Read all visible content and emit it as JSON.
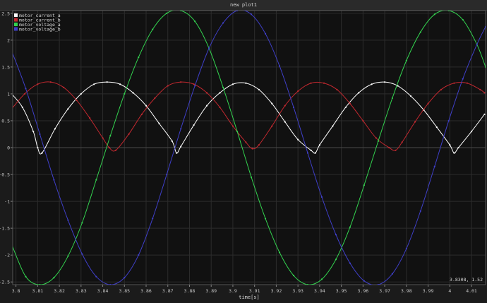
{
  "window": {
    "title": "new plot1"
  },
  "cursor_readout": "3.8308, 1.52",
  "chart_data": {
    "type": "line",
    "title": "new plot1",
    "xlabel": "time[s]",
    "ylabel": "",
    "xlim": [
      3.7985,
      4.0165
    ],
    "ylim": [
      -2.55,
      2.55
    ],
    "grid": true,
    "legend_position": "top-left",
    "x_ticks": [
      3.8,
      3.81,
      3.82,
      3.83,
      3.84,
      3.85,
      3.86,
      3.87,
      3.88,
      3.89,
      3.9,
      3.91,
      3.92,
      3.93,
      3.94,
      3.95,
      3.96,
      3.97,
      3.98,
      3.99,
      4.0,
      4.01
    ],
    "x_tick_labels": [
      "3.8",
      "3.81",
      "3.82",
      "3.83",
      "3.84",
      "3.85",
      "3.86",
      "3.87",
      "3.88",
      "3.89",
      "3.9",
      "3.91",
      "3.92",
      "3.93",
      "3.94",
      "3.95",
      "3.96",
      "3.97",
      "3.98",
      "3.99",
      "4",
      "4.01"
    ],
    "y_ticks": [
      2.5,
      2,
      1.5,
      1,
      0.5,
      0,
      -0.5,
      -1,
      -1.5,
      -2,
      -2.5
    ],
    "y_tick_labels": [
      "2.5",
      "2",
      "1.5",
      "1",
      "0.5",
      "0",
      "-0.5",
      "-1",
      "-1.5",
      "-2",
      "-2.5"
    ],
    "series": [
      {
        "name": "motor_current_a",
        "color": "#ffffff",
        "x": [
          3.798,
          3.803,
          3.808,
          3.81,
          3.812,
          3.818,
          3.824,
          3.83,
          3.836,
          3.842,
          3.848,
          3.854,
          3.86,
          3.866,
          3.872,
          3.874,
          3.876,
          3.882,
          3.888,
          3.894,
          3.9,
          3.906,
          3.912,
          3.918,
          3.924,
          3.93,
          3.936,
          3.938,
          3.94,
          3.946,
          3.952,
          3.958,
          3.964,
          3.97,
          3.976,
          3.982,
          3.988,
          3.994,
          4.0,
          4.002,
          4.004,
          4.01,
          4.016
        ],
        "y": [
          1.0,
          0.75,
          0.3,
          0.0,
          -0.1,
          0.35,
          0.72,
          1.0,
          1.18,
          1.22,
          1.18,
          1.02,
          0.78,
          0.45,
          0.12,
          -0.1,
          0.02,
          0.42,
          0.78,
          1.02,
          1.18,
          1.2,
          1.08,
          0.82,
          0.48,
          0.15,
          -0.05,
          -0.1,
          0.05,
          0.4,
          0.75,
          1.02,
          1.18,
          1.22,
          1.15,
          0.96,
          0.7,
          0.38,
          0.05,
          -0.1,
          0.0,
          0.3,
          0.62
        ]
      },
      {
        "name": "motor_current_b",
        "color": "#c0282f",
        "x": [
          3.798,
          3.804,
          3.81,
          3.816,
          3.822,
          3.828,
          3.834,
          3.84,
          3.843,
          3.846,
          3.852,
          3.858,
          3.864,
          3.87,
          3.876,
          3.882,
          3.888,
          3.894,
          3.9,
          3.906,
          3.909,
          3.912,
          3.918,
          3.924,
          3.93,
          3.936,
          3.942,
          3.948,
          3.954,
          3.96,
          3.966,
          3.972,
          3.975,
          3.978,
          3.984,
          3.99,
          3.996,
          4.002,
          4.008,
          4.014,
          4.016
        ],
        "y": [
          0.72,
          1.0,
          1.18,
          1.22,
          1.12,
          0.88,
          0.55,
          0.18,
          0.0,
          -0.05,
          0.25,
          0.62,
          0.92,
          1.15,
          1.22,
          1.18,
          1.02,
          0.75,
          0.4,
          0.1,
          -0.02,
          0.05,
          0.4,
          0.78,
          1.05,
          1.2,
          1.2,
          1.08,
          0.82,
          0.5,
          0.18,
          0.0,
          -0.05,
          0.1,
          0.48,
          0.82,
          1.08,
          1.2,
          1.2,
          1.08,
          1.02
        ]
      },
      {
        "name": "motor_voltage_a",
        "color": "#33d24f",
        "x": [
          3.798,
          3.8045,
          3.811,
          3.8175,
          3.824,
          3.8305,
          3.837,
          3.8435,
          3.85,
          3.8565,
          3.863,
          3.8695,
          3.876,
          3.8825,
          3.889,
          3.8955,
          3.902,
          3.9085,
          3.915,
          3.9215,
          3.928,
          3.9345,
          3.941,
          3.9475,
          3.954,
          3.9605,
          3.967,
          3.9735,
          3.98,
          3.9865,
          3.993,
          3.9995,
          4.006,
          4.0125,
          4.0165
        ],
        "y": [
          -1.8,
          -2.4,
          -2.55,
          -2.42,
          -2.02,
          -1.4,
          -0.6,
          0.22,
          1.0,
          1.68,
          2.2,
          2.5,
          2.55,
          2.35,
          1.85,
          1.12,
          0.3,
          -0.55,
          -1.32,
          -1.95,
          -2.38,
          -2.55,
          -2.45,
          -2.08,
          -1.48,
          -0.7,
          0.12,
          0.92,
          1.62,
          2.15,
          2.48,
          2.55,
          2.38,
          1.92,
          1.5
        ]
      },
      {
        "name": "motor_voltage_b",
        "color": "#3f3fc8",
        "x": [
          3.798,
          3.8045,
          3.811,
          3.8175,
          3.824,
          3.8305,
          3.837,
          3.8435,
          3.85,
          3.8565,
          3.863,
          3.8695,
          3.876,
          3.8825,
          3.889,
          3.8955,
          3.902,
          3.9085,
          3.915,
          3.9215,
          3.928,
          3.9345,
          3.941,
          3.9475,
          3.954,
          3.9605,
          3.967,
          3.9735,
          3.98,
          3.9865,
          3.993,
          3.9995,
          4.006,
          4.0125,
          4.0165
        ],
        "y": [
          1.8,
          1.1,
          0.25,
          -0.6,
          -1.35,
          -1.98,
          -2.4,
          -2.55,
          -2.42,
          -2.0,
          -1.32,
          -0.5,
          0.35,
          1.15,
          1.85,
          2.32,
          2.55,
          2.48,
          2.12,
          1.52,
          0.75,
          -0.1,
          -0.92,
          -1.62,
          -2.15,
          -2.48,
          -2.55,
          -2.35,
          -1.88,
          -1.18,
          -0.35,
          0.5,
          1.28,
          1.92,
          2.25
        ]
      }
    ]
  }
}
